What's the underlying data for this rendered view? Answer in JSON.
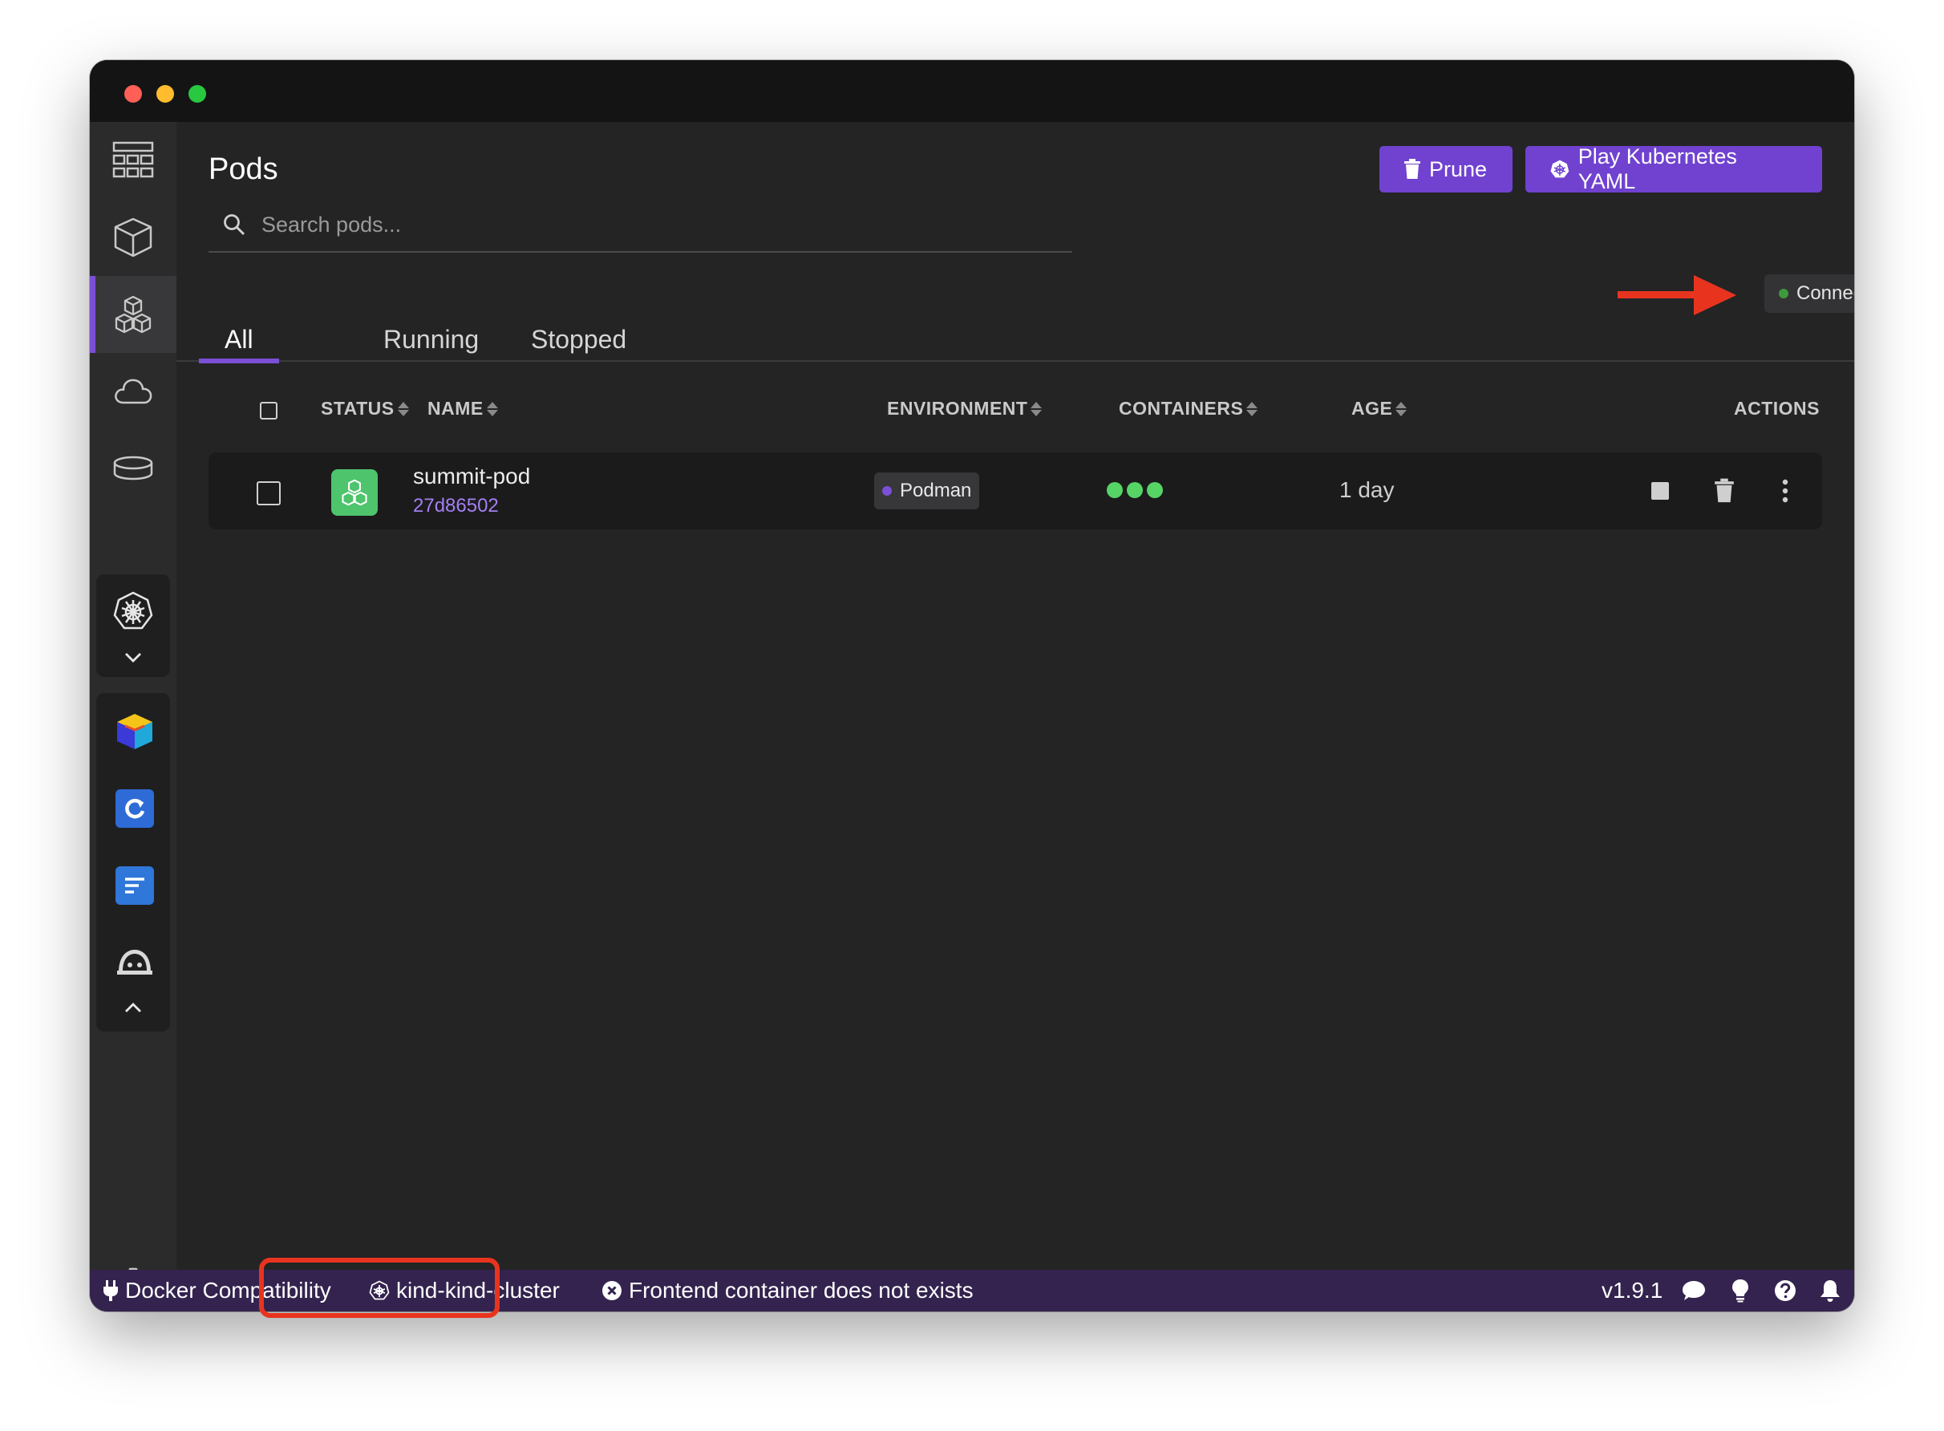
{
  "page": {
    "title": "Pods",
    "prune_label": "Prune",
    "play_label": "Play Kubernetes YAML",
    "search_placeholder": "Search pods...",
    "connection_status": "Connected"
  },
  "tabs": [
    {
      "label": "All",
      "active": true
    },
    {
      "label": "Running",
      "active": false
    },
    {
      "label": "Stopped",
      "active": false
    }
  ],
  "table": {
    "columns": [
      "STATUS",
      "NAME",
      "ENVIRONMENT",
      "CONTAINERS",
      "AGE",
      "ACTIONS"
    ],
    "rows": [
      {
        "name": "summit-pod",
        "id": "27d86502",
        "environment": "Podman",
        "containers": 3,
        "age": "1 day",
        "status_color": "#4ec46d"
      }
    ]
  },
  "sidebar": {
    "items": [
      "dashboard-icon",
      "containers-icon",
      "pods-icon",
      "images-icon",
      "volumes-icon",
      "kubernetes-icon",
      "settings-icon"
    ],
    "extensions": [
      "cube-extension-icon",
      "refresh-extension-icon",
      "notes-extension-icon",
      "bot-extension-icon"
    ]
  },
  "statusbar": {
    "docker": "Docker Compatibility",
    "cluster": "kind-kind-cluster",
    "error": "Frontend container does not exists",
    "version": "v1.9.1"
  },
  "colors": {
    "accent": "#7042cf",
    "running": "#56d466",
    "annotation": "#e8341f"
  }
}
